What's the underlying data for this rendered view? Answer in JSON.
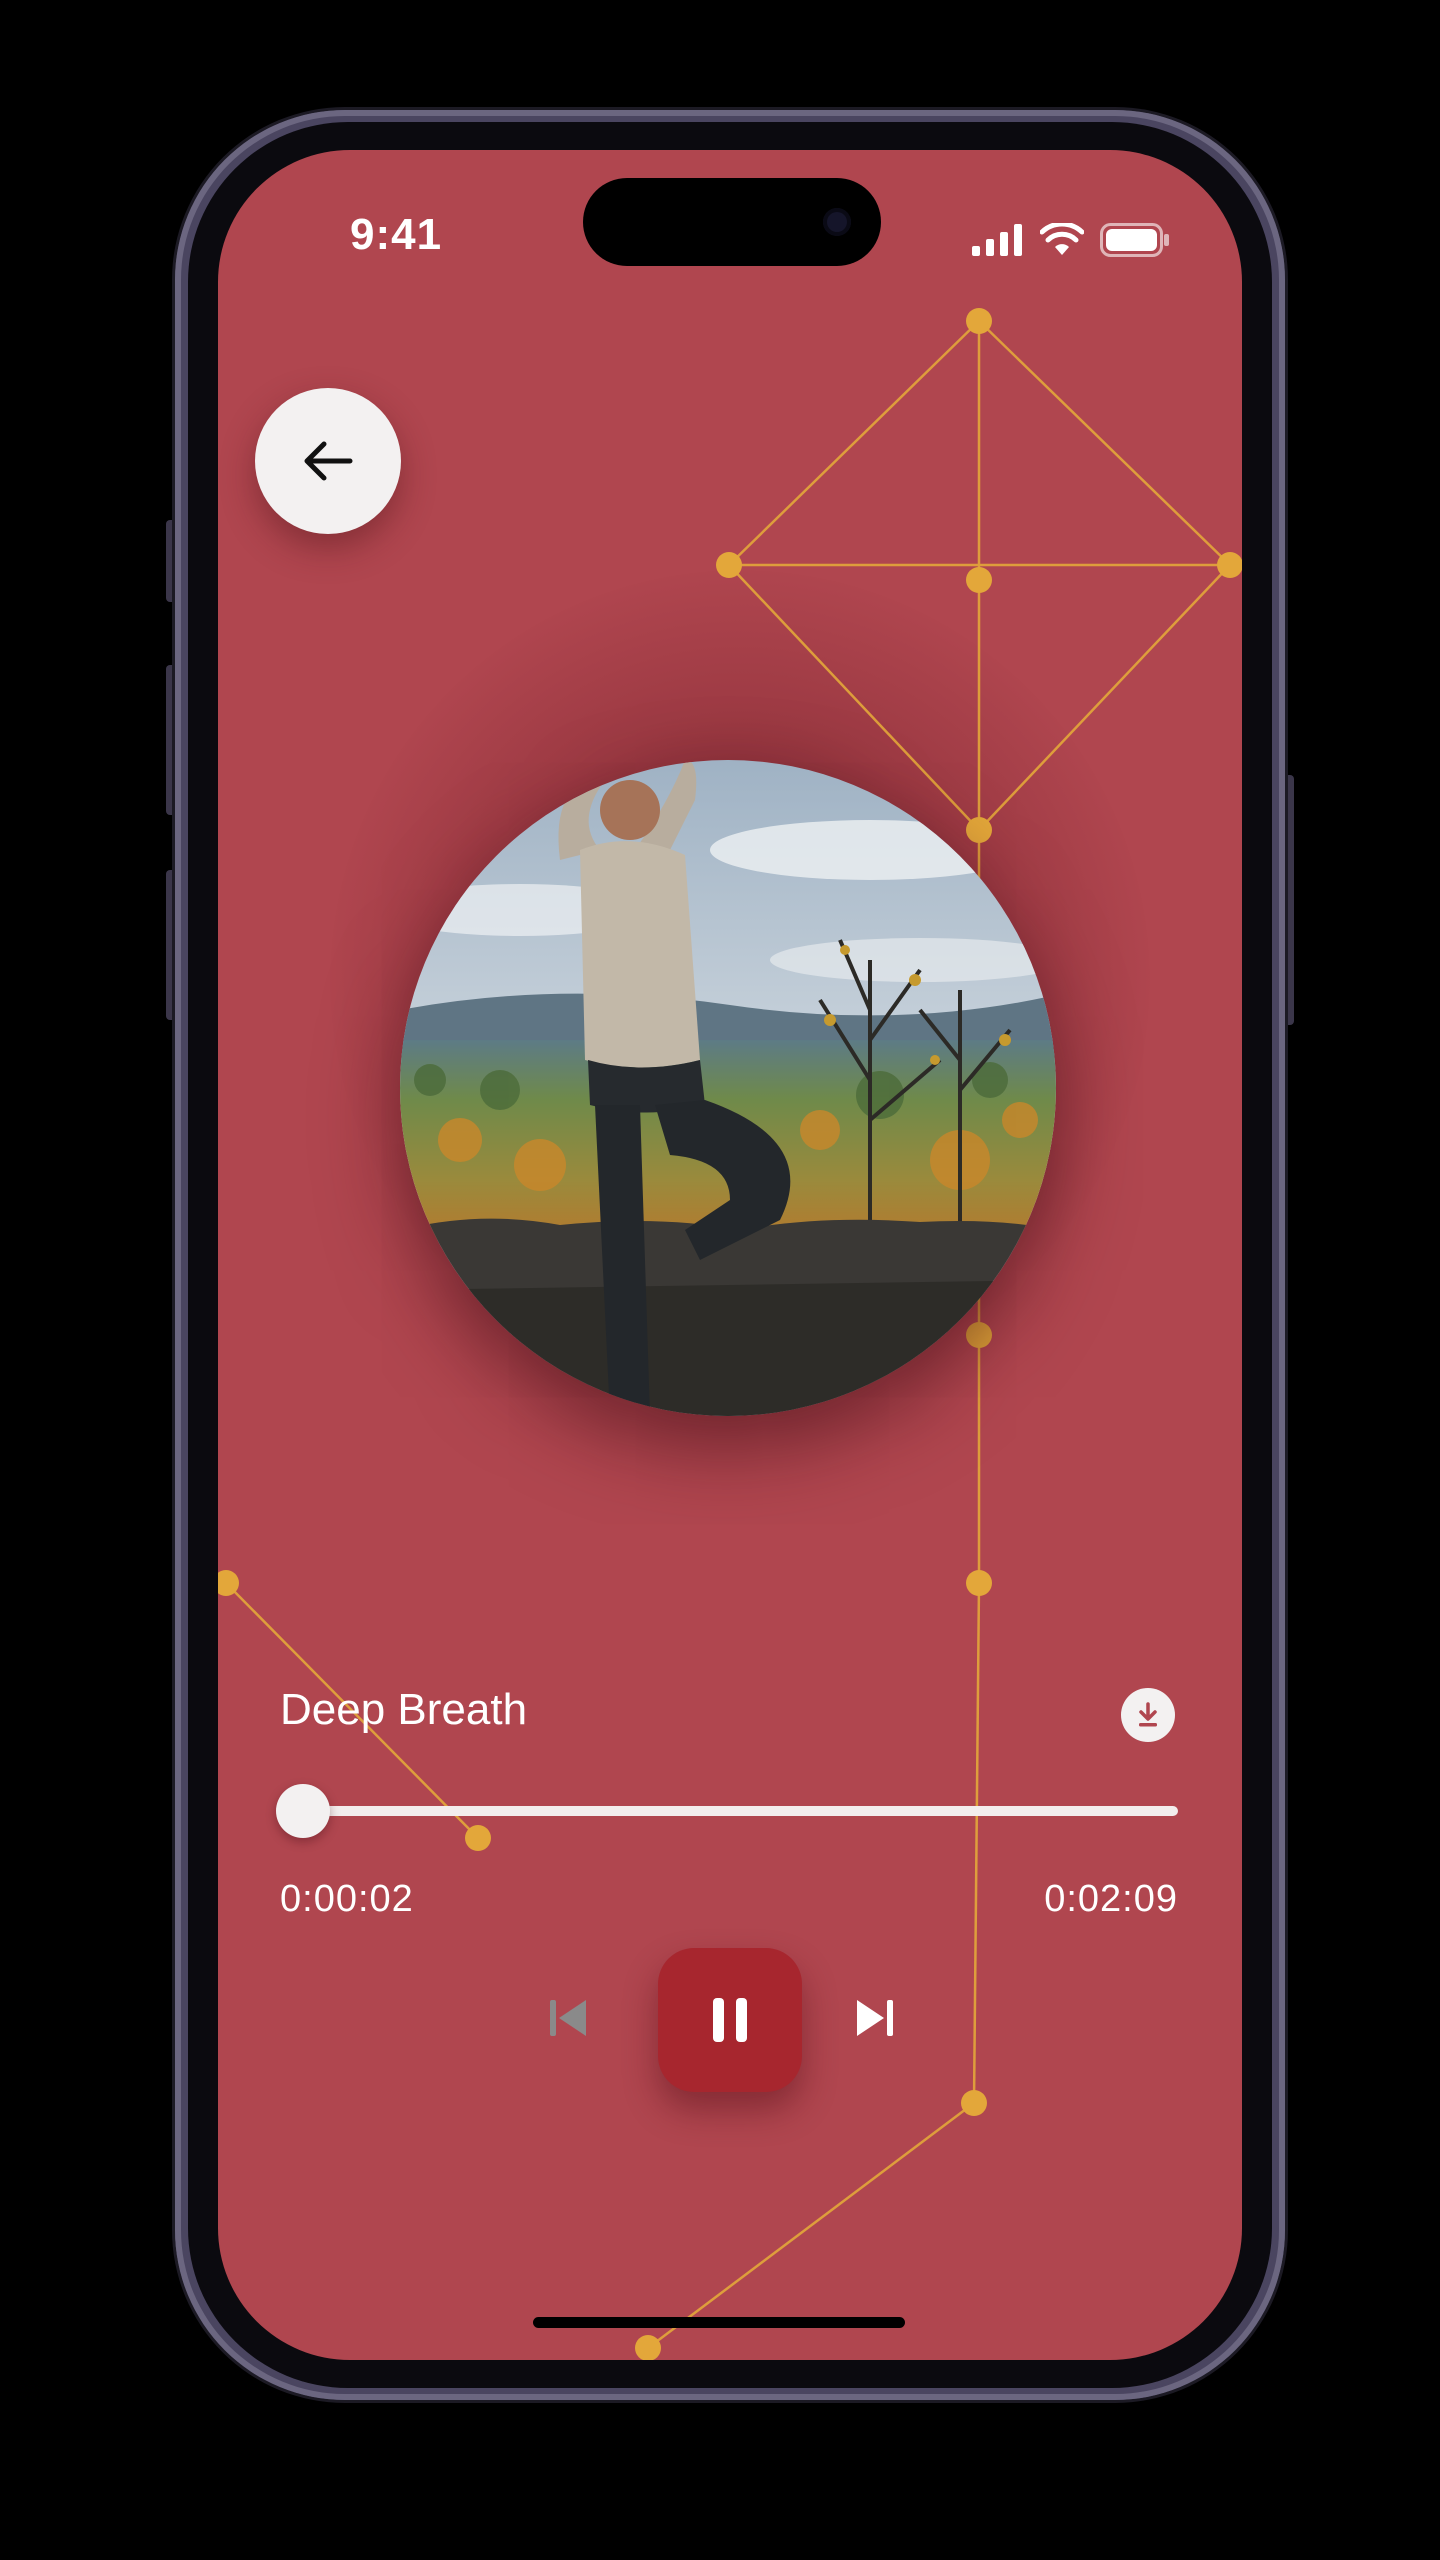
{
  "status_bar": {
    "time": "9:41",
    "signal_icon": "cellular-signal-icon",
    "wifi_icon": "wifi-icon",
    "battery_icon": "battery-icon"
  },
  "header": {
    "back_icon": "arrow-left-icon"
  },
  "artwork": {
    "subject": "person in tree pose yoga over autumn forest valley"
  },
  "player": {
    "title": "Deep Breath",
    "download_icon": "download-icon",
    "elapsed": "0:00:02",
    "duration": "0:02:09",
    "progress": 0.016,
    "prev_icon": "skip-previous-icon",
    "play_state_icon": "pause-icon",
    "next_icon": "skip-next-icon"
  },
  "colors": {
    "background": "#b0464f",
    "accent_button": "#a7262e",
    "constellation": "#e3a73a",
    "frame": "#4a4560"
  }
}
